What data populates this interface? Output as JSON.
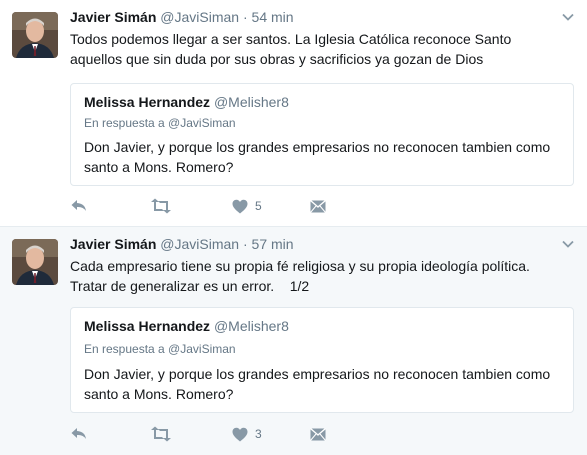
{
  "tweets": [
    {
      "name": "Javier Simán",
      "handle": "@JaviSiman",
      "separator": "·",
      "time": "54 min",
      "text_line1": "Todos podemos llegar a ser santos. La Iglesia Católica reconoce Santo",
      "text_line2": "aquellos que sin duda por sus obras y sacrificios ya gozan de Dios",
      "quote": {
        "name": "Melissa Hernandez",
        "handle": "@Melisher8",
        "reply_to": "En respuesta a @JaviSiman",
        "text_line1": "Don Javier, y porque los grandes empresarios no reconocen tambien como",
        "text_line2": "santo a Mons. Romero?"
      },
      "likes": "5"
    },
    {
      "name": "Javier Simán",
      "handle": "@JaviSiman",
      "separator": "·",
      "time": "57 min",
      "text_line1": "Cada empresario tiene su propia fé religiosa y su propia ideología política.",
      "text_line2": "Tratar de generalizar es un error.    1/2",
      "quote": {
        "name": "Melissa Hernandez",
        "handle": "@Melisher8",
        "reply_to": "En respuesta a @JaviSiman",
        "text_line1": "Don Javier, y porque los grandes empresarios no reconocen tambien como",
        "text_line2": "santo a Mons. Romero?"
      },
      "likes": "3"
    }
  ],
  "icons": {
    "reply": "reply-icon",
    "retweet": "retweet-icon",
    "like": "heart-icon",
    "message": "direct-message-icon",
    "menu": "chevron-down-icon"
  },
  "colors": {
    "text": "#14171a",
    "muted": "#657786",
    "icon": "#8899a6",
    "border": "#e1e8ed",
    "alt_background": "#f5f8fa"
  }
}
